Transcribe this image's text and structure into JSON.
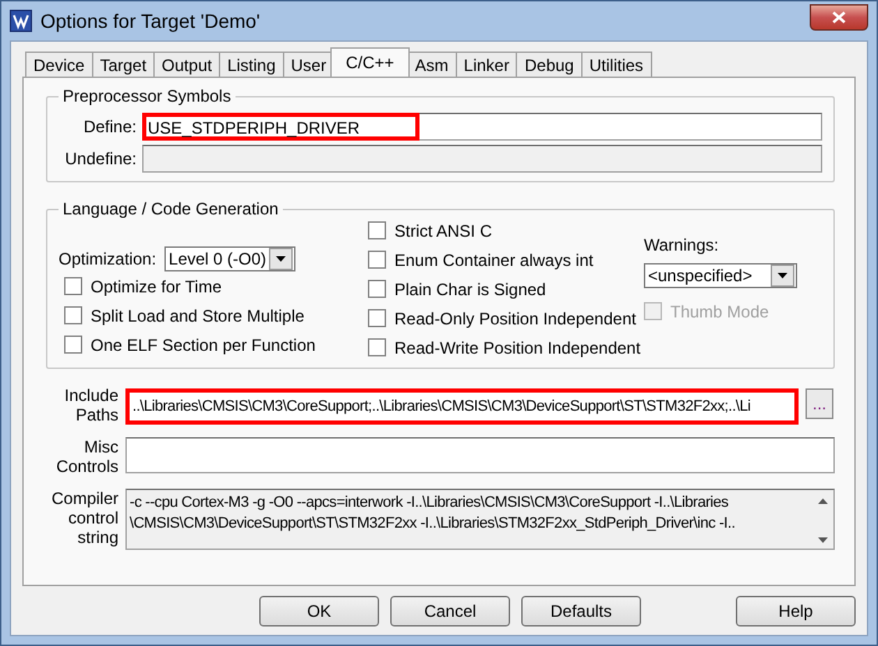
{
  "window": {
    "title": "Options for Target 'Demo'"
  },
  "tabs": [
    {
      "label": "Device",
      "selected": false
    },
    {
      "label": "Target",
      "selected": false
    },
    {
      "label": "Output",
      "selected": false
    },
    {
      "label": "Listing",
      "selected": false
    },
    {
      "label": "User",
      "selected": false
    },
    {
      "label": "C/C++",
      "selected": true
    },
    {
      "label": "Asm",
      "selected": false
    },
    {
      "label": "Linker",
      "selected": false
    },
    {
      "label": "Debug",
      "selected": false
    },
    {
      "label": "Utilities",
      "selected": false
    }
  ],
  "preprocessor": {
    "title": "Preprocessor Symbols",
    "define": {
      "label": "Define:",
      "value": "USE_STDPERIPH_DRIVER",
      "highlighted": true,
      "disabled": false
    },
    "undefine": {
      "label": "Undefine:",
      "highlighted": false,
      "disabled": true
    }
  },
  "language": {
    "title": "Language / Code Generation",
    "optimization": {
      "label": "Optimization:",
      "value": "Level 0 (-O0)"
    },
    "left_options": [
      {
        "label": "Optimize for Time",
        "checked": false,
        "disabled": false
      },
      {
        "label": "Split Load and Store Multiple",
        "checked": false,
        "disabled": false
      },
      {
        "label": "One ELF Section per Function",
        "checked": false,
        "disabled": false
      }
    ],
    "middle_options": [
      {
        "label": "Strict ANSI C",
        "checked": false,
        "disabled": false
      },
      {
        "label": "Enum Container always int",
        "checked": false,
        "disabled": false
      },
      {
        "label": "Plain Char is Signed",
        "checked": false,
        "disabled": false
      },
      {
        "label": "Read-Only Position Independent",
        "checked": false,
        "disabled": false
      },
      {
        "label": "Read-Write Position Independent",
        "checked": false,
        "disabled": false
      }
    ],
    "warnings": {
      "label": "Warnings:",
      "value": "<unspecified>"
    },
    "thumb_mode": {
      "label": "Thumb Mode",
      "checked": false,
      "disabled": true
    }
  },
  "include_paths": {
    "label": "Include Paths",
    "value": "..\\Libraries\\CMSIS\\CM3\\CoreSupport;..\\Libraries\\CMSIS\\CM3\\DeviceSupport\\ST\\STM32F2xx;..\\Li",
    "highlighted": true,
    "browse": "..."
  },
  "misc_controls": {
    "label": "Misc Controls"
  },
  "compiler_string": {
    "label": "Compiler control string",
    "lines": [
      "-c --cpu Cortex-M3 -g -O0 --apcs=interwork -I..\\Libraries\\CMSIS\\CM3\\CoreSupport -I..\\Libraries",
      "\\CMSIS\\CM3\\DeviceSupport\\ST\\STM32F2xx -I..\\Libraries\\STM32F2xx_StdPeriph_Driver\\inc -I.."
    ]
  },
  "buttons": [
    "OK",
    "Cancel",
    "Defaults",
    "Help"
  ]
}
